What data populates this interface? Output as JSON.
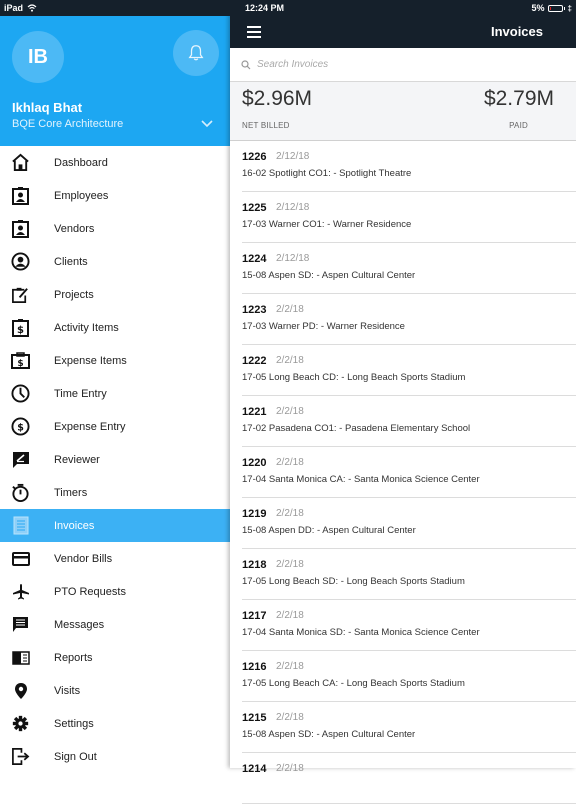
{
  "status_bar": {
    "device": "iPad",
    "time": "12:24 PM",
    "battery": "5%"
  },
  "sidebar": {
    "avatar_initials": "IB",
    "user_name": "Ikhlaq Bhat",
    "organization": "BQE Core Architecture",
    "accent_color": "#1da7f2",
    "items": [
      {
        "label": "Dashboard",
        "icon": "home-icon"
      },
      {
        "label": "Employees",
        "icon": "employee-badge-icon"
      },
      {
        "label": "Vendors",
        "icon": "vendor-badge-icon"
      },
      {
        "label": "Clients",
        "icon": "client-circle-icon"
      },
      {
        "label": "Projects",
        "icon": "project-clipboard-icon"
      },
      {
        "label": "Activity Items",
        "icon": "activity-dollar-icon"
      },
      {
        "label": "Expense Items",
        "icon": "expense-dollar-icon"
      },
      {
        "label": "Time Entry",
        "icon": "clock-icon"
      },
      {
        "label": "Expense Entry",
        "icon": "dollar-circle-icon"
      },
      {
        "label": "Reviewer",
        "icon": "reviewer-icon"
      },
      {
        "label": "Timers",
        "icon": "stopwatch-icon"
      },
      {
        "label": "Invoices",
        "icon": "invoice-icon",
        "active": true
      },
      {
        "label": "Vendor Bills",
        "icon": "credit-card-icon"
      },
      {
        "label": "PTO Requests",
        "icon": "airplane-icon"
      },
      {
        "label": "Messages",
        "icon": "message-icon"
      },
      {
        "label": "Reports",
        "icon": "report-icon"
      },
      {
        "label": "Visits",
        "icon": "location-pin-icon"
      },
      {
        "label": "Settings",
        "icon": "gear-icon"
      },
      {
        "label": "Sign Out",
        "icon": "sign-out-icon"
      }
    ]
  },
  "header": {
    "title": "Invoices"
  },
  "search": {
    "placeholder": "Search Invoices",
    "value": ""
  },
  "summary": {
    "net_billed_value": "$2.96M",
    "net_billed_label": "NET BILLED",
    "paid_value": "$2.79M",
    "paid_label": "PAID"
  },
  "invoices": [
    {
      "number": "1226",
      "date": "2/12/18",
      "description": "16-02 Spotlight CO1: - Spotlight Theatre"
    },
    {
      "number": "1225",
      "date": "2/12/18",
      "description": "17-03 Warner CO1: - Warner Residence"
    },
    {
      "number": "1224",
      "date": "2/12/18",
      "description": "15-08 Aspen SD: - Aspen Cultural Center"
    },
    {
      "number": "1223",
      "date": "2/2/18",
      "description": "17-03 Warner PD: - Warner Residence"
    },
    {
      "number": "1222",
      "date": "2/2/18",
      "description": "17-05 Long Beach CD: - Long Beach Sports Stadium"
    },
    {
      "number": "1221",
      "date": "2/2/18",
      "description": "17-02 Pasadena CO1: - Pasadena Elementary School"
    },
    {
      "number": "1220",
      "date": "2/2/18",
      "description": "17-04 Santa Monica CA: - Santa Monica Science Center"
    },
    {
      "number": "1219",
      "date": "2/2/18",
      "description": "15-08 Aspen DD: - Aspen Cultural Center"
    },
    {
      "number": "1218",
      "date": "2/2/18",
      "description": "17-05 Long Beach SD: - Long Beach Sports Stadium"
    },
    {
      "number": "1217",
      "date": "2/2/18",
      "description": "17-04 Santa Monica SD: - Santa Monica Science Center"
    },
    {
      "number": "1216",
      "date": "2/2/18",
      "description": "17-05 Long Beach CA: - Long Beach Sports Stadium"
    },
    {
      "number": "1215",
      "date": "2/2/18",
      "description": "15-08 Aspen SD: - Aspen Cultural Center"
    },
    {
      "number": "1214",
      "date": "2/2/18",
      "description": ""
    }
  ]
}
